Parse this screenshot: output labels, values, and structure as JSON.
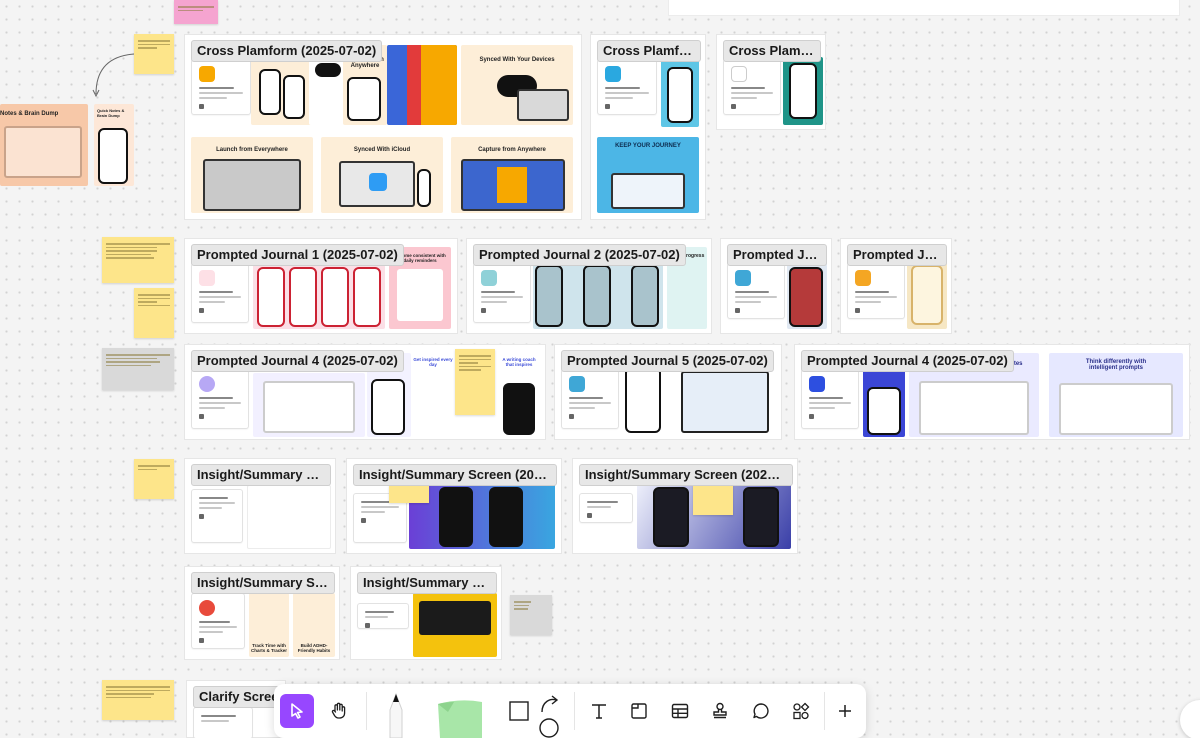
{
  "sections": {
    "cross_1": "Cross Plamform (2025-07-02)",
    "cross_2": "Cross Plamform...",
    "cross_3": "Cross Plamfor...",
    "prompted_1": "Prompted Journal 1 (2025-07-02)",
    "prompted_2": "Prompted Journal 2 (2025-07-02)",
    "prompted_3": "Prompted Jour...",
    "prompted_3b": "Prompted Jour...",
    "prompted_4": "Prompted Journal 4 (2025-07-02)",
    "prompted_5": "Prompted Journal 5 (2025-07-02)",
    "prompted_4b": "Prompted Journal 4 (2025-07-02)",
    "insight_1": "Insight/Summary Scre...",
    "insight_2": "Insight/Summary Screen (2025-07...",
    "insight_3": "Insight/Summary Screen (2025-07-...",
    "insight_4": "Insight/Summary Scre...",
    "insight_5": "Insight/Summary Scre...",
    "clarify": "Clarify Screen"
  },
  "tiles": {
    "launch": "Launch from Everywhere",
    "synced_icloud": "Synced With iCloud",
    "capture": "Capture from Anywhere",
    "capture_top": "Capture from Anywhere",
    "synced_devices": "Synced With Your Devices",
    "keep_journey": "KEEP YOUR JOURNEY",
    "become_consistent": "Become consistent with daily reminders",
    "track_progress": "track progress",
    "think_differently": "Think differently with intelligent prompts",
    "templates": "and ... consistency with templates",
    "track_time": "Track Time with Charts & Tracker",
    "build_adhd": "Build ADHD-Friendly Habits",
    "notes_brain_dump": "Notes & Brain Dump",
    "quick_notes": "Quick Notes & Brain Dump",
    "get_inspired": "Get inspired every day",
    "writing_coach": "A writing coach that inspires"
  },
  "toolbar": {
    "tools": [
      "select",
      "hand",
      "pen",
      "sticky",
      "shape",
      "text",
      "section",
      "table",
      "stamp",
      "comment",
      "more",
      "add"
    ],
    "active": "select",
    "accent": "#9747ff"
  },
  "colors": {
    "sticky": "#fde58a",
    "grey_note": "#d9d9d9",
    "pink_note": "#f5a4d0"
  }
}
